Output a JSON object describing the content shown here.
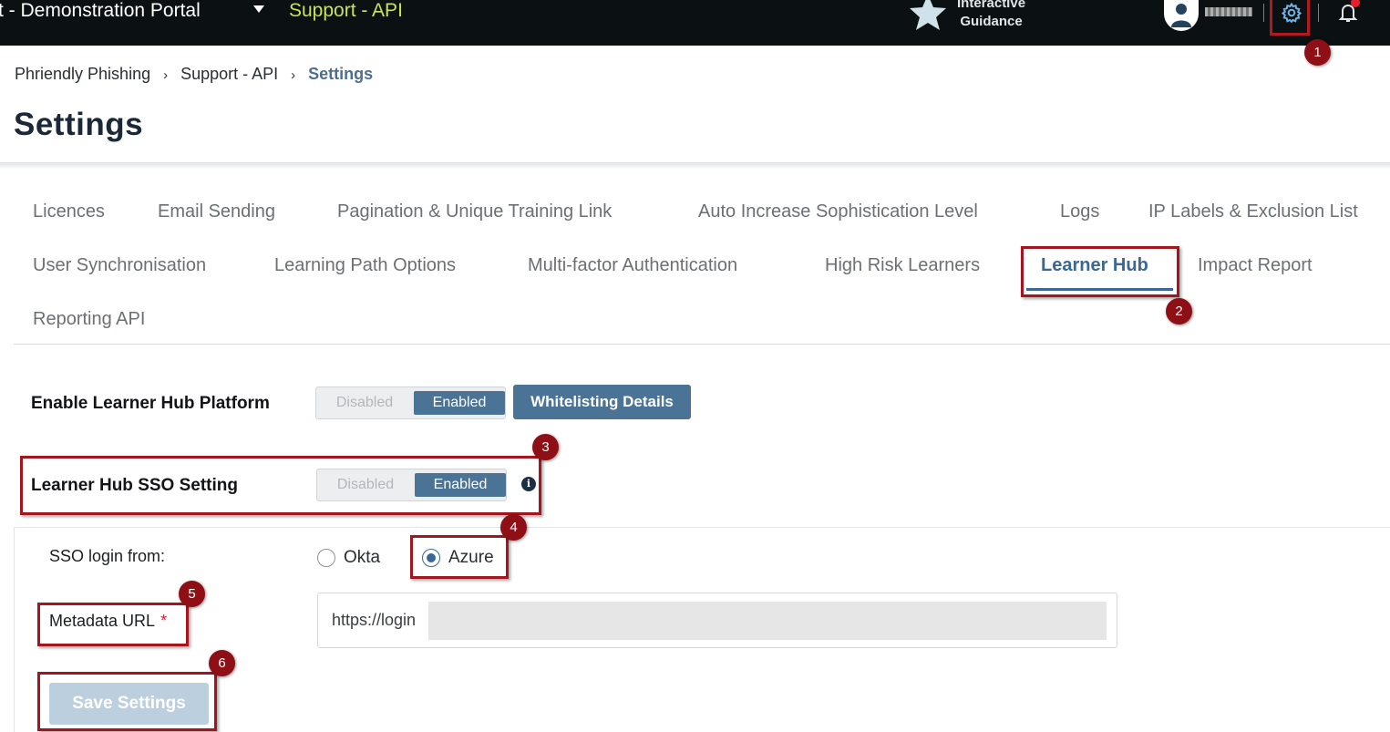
{
  "topbar": {
    "portal_name": "t - Demonstration Portal",
    "product_name": "Support - API",
    "guidance_line1": "Interactive",
    "guidance_line2": "Guidance",
    "icons": [
      "star-icon",
      "user-avatar-icon",
      "gear-icon",
      "bell-icon"
    ],
    "product_color": "#c8e356"
  },
  "breadcrumb": {
    "items": [
      "Phriendly Phishing",
      "Support - API",
      "Settings"
    ],
    "separator": "›"
  },
  "page": {
    "title": "Settings"
  },
  "tabs": [
    "Licences",
    "Email Sending",
    "Pagination & Unique Training Link",
    "Auto Increase Sophistication Level",
    "Logs",
    "IP Labels & Exclusion List",
    "User Synchronisation",
    "Learning Path Options",
    "Multi-factor Authentication",
    "High Risk Learners",
    "Learner Hub",
    "Impact Report",
    "Reporting API"
  ],
  "active_tab": "Learner Hub",
  "learner_hub": {
    "platform_label": "Enable Learner Hub Platform",
    "platform_toggle": {
      "off": "Disabled",
      "on": "Enabled",
      "selected": "Enabled"
    },
    "whitelisting_button": "Whitelisting Details",
    "sso_label": "Learner Hub SSO Setting",
    "sso_toggle": {
      "off": "Disabled",
      "on": "Enabled",
      "selected": "Enabled"
    },
    "info_glyph": "i",
    "sso_login_from_label": "SSO login from:",
    "sso_options": [
      "Okta",
      "Azure"
    ],
    "sso_selected": "Azure",
    "metadata_label": "Metadata URL",
    "required_mark": "*",
    "metadata_value": "https://login",
    "save_button": "Save Settings"
  },
  "callouts": [
    "1",
    "2",
    "3",
    "4",
    "5",
    "6"
  ],
  "colors": {
    "accent": "#4a7396",
    "callout": "#a3161e",
    "topbar": "#0b1113"
  }
}
